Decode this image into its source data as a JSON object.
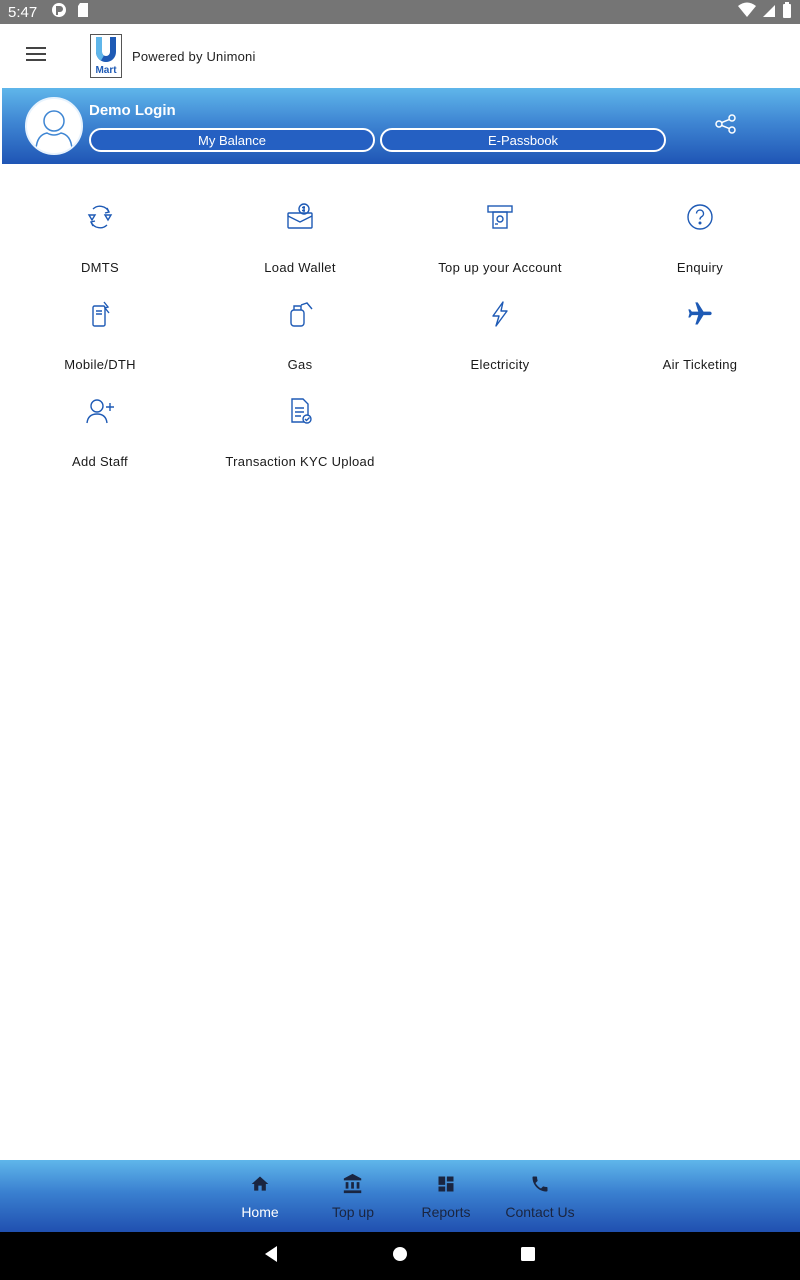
{
  "status_bar": {
    "time": "5:47",
    "left_icons": [
      "app-notification-icon",
      "sd-card-icon"
    ],
    "right_icons": [
      "wifi-icon",
      "cell-signal-icon",
      "battery-icon"
    ]
  },
  "app_bar": {
    "menu_icon": "hamburger-menu-icon",
    "logo_letter": "U",
    "logo_sub": "Mart",
    "powered_by": "Powered by Unimoni"
  },
  "profile": {
    "name": "Demo Login",
    "balance_label": "My Balance",
    "passbook_label": "E-Passbook",
    "share_icon": "share-icon"
  },
  "services": [
    {
      "label": "DMTS",
      "icon": "money-transfer-icon"
    },
    {
      "label": "Load Wallet",
      "icon": "wallet-icon"
    },
    {
      "label": "Top up your Account",
      "icon": "atm-cash-icon"
    },
    {
      "label": "Enquiry",
      "icon": "question-icon"
    },
    {
      "label": "Mobile/DTH",
      "icon": "mobile-recharge-icon"
    },
    {
      "label": "Gas",
      "icon": "gas-cylinder-icon"
    },
    {
      "label": "Electricity",
      "icon": "lightning-icon"
    },
    {
      "label": "Air Ticketing",
      "icon": "airplane-icon"
    },
    {
      "label": "Add Staff",
      "icon": "add-user-icon"
    },
    {
      "label": "Transaction KYC Upload",
      "icon": "document-check-icon"
    }
  ],
  "bottom_nav": [
    {
      "label": "Home",
      "icon": "home-icon",
      "active": true
    },
    {
      "label": "Top up",
      "icon": "bank-icon",
      "active": false
    },
    {
      "label": "Reports",
      "icon": "dashboard-icon",
      "active": false
    },
    {
      "label": "Contact Us",
      "icon": "phone-icon",
      "active": false
    }
  ],
  "system_nav": [
    "back-icon",
    "home-circle-icon",
    "recents-square-icon"
  ],
  "colors": {
    "brand_blue": "#1f55b5",
    "brand_light_blue": "#5fb6ea",
    "icon_blue": "#1e5ab5",
    "status_bar": "#757575"
  }
}
